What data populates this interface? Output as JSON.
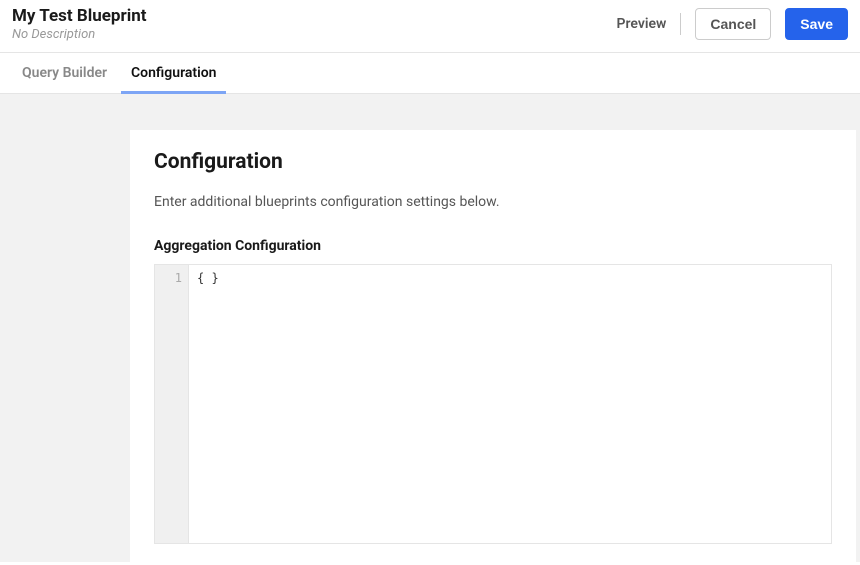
{
  "header": {
    "title": "My Test Blueprint",
    "description": "No Description",
    "preview_label": "Preview",
    "cancel_label": "Cancel",
    "save_label": "Save"
  },
  "tabs": {
    "query_builder": "Query Builder",
    "configuration": "Configuration"
  },
  "panel": {
    "title": "Configuration",
    "description": "Enter additional blueprints configuration settings below.",
    "section_label": "Aggregation Configuration",
    "editor": {
      "line_number": "1",
      "content": "{ }"
    }
  }
}
